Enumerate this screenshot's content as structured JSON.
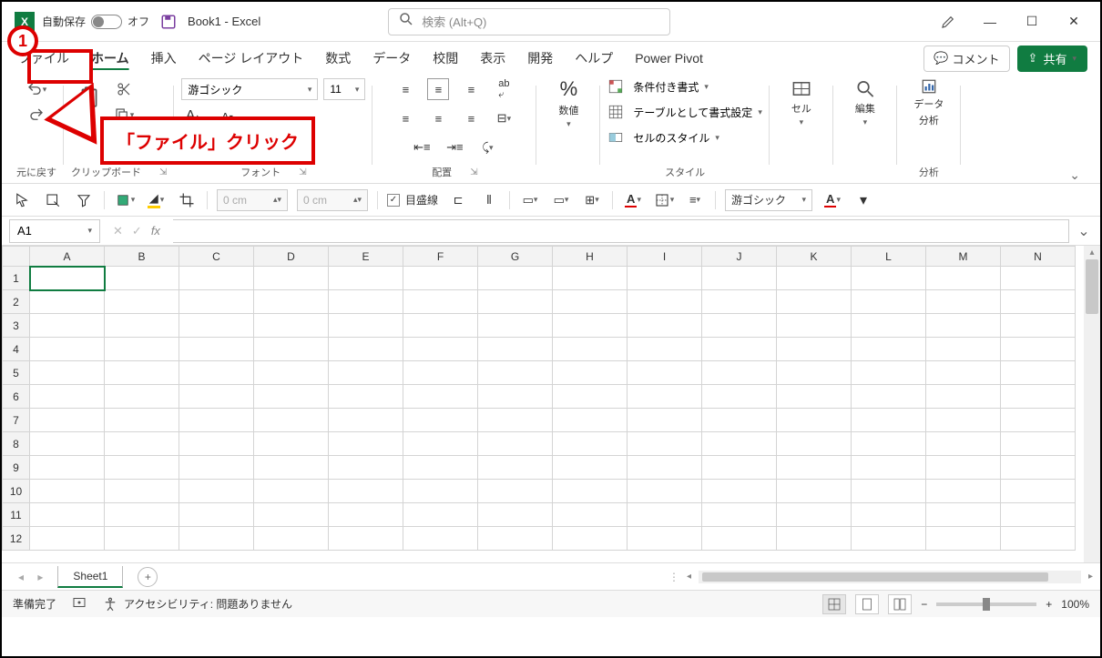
{
  "title": {
    "autosave_label": "自動保存",
    "autosave_state": "オフ",
    "doc": "Book1  -  Excel",
    "search_placeholder": "検索 (Alt+Q)"
  },
  "tabs": {
    "file": "ファイル",
    "home": "ホーム",
    "insert": "挿入",
    "pagelayout": "ページ レイアウト",
    "formulas": "数式",
    "data": "データ",
    "review": "校閲",
    "view": "表示",
    "developer": "開発",
    "help": "ヘルプ",
    "powerpivot": "Power Pivot",
    "comment": "コメント",
    "share": "共有"
  },
  "ribbon": {
    "undo_label": "元に戻す",
    "clipboard_label": "クリップボード",
    "font_label": "フォント",
    "align_label": "配置",
    "number_label": "数値",
    "styles_label": "スタイル",
    "cells_label": "セル",
    "editing_label": "編集",
    "analysis_label1": "データ",
    "analysis_label2": "分析",
    "analysis_group": "分析",
    "font_name": "游ゴシック",
    "font_size": "11",
    "cond_fmt": "条件付き書式",
    "table_fmt": "テーブルとして書式設定",
    "cell_style": "セルのスタイル"
  },
  "toolbar2": {
    "dim1": "0 cm",
    "dim2": "0 cm",
    "gridlines": "目盛線",
    "font2": "游ゴシック"
  },
  "formula": {
    "namebox": "A1"
  },
  "grid": {
    "cols": [
      "A",
      "B",
      "C",
      "D",
      "E",
      "F",
      "G",
      "H",
      "I",
      "J",
      "K",
      "L",
      "M",
      "N"
    ],
    "rows": [
      "1",
      "2",
      "3",
      "4",
      "5",
      "6",
      "7",
      "8",
      "9",
      "10",
      "11",
      "12"
    ]
  },
  "sheets": {
    "sheet1": "Sheet1"
  },
  "status": {
    "ready": "準備完了",
    "accessibility": "アクセシビリティ: 問題ありません",
    "zoom": "100%"
  },
  "annotation": {
    "num": "1",
    "text": "「ファイル」クリック"
  }
}
